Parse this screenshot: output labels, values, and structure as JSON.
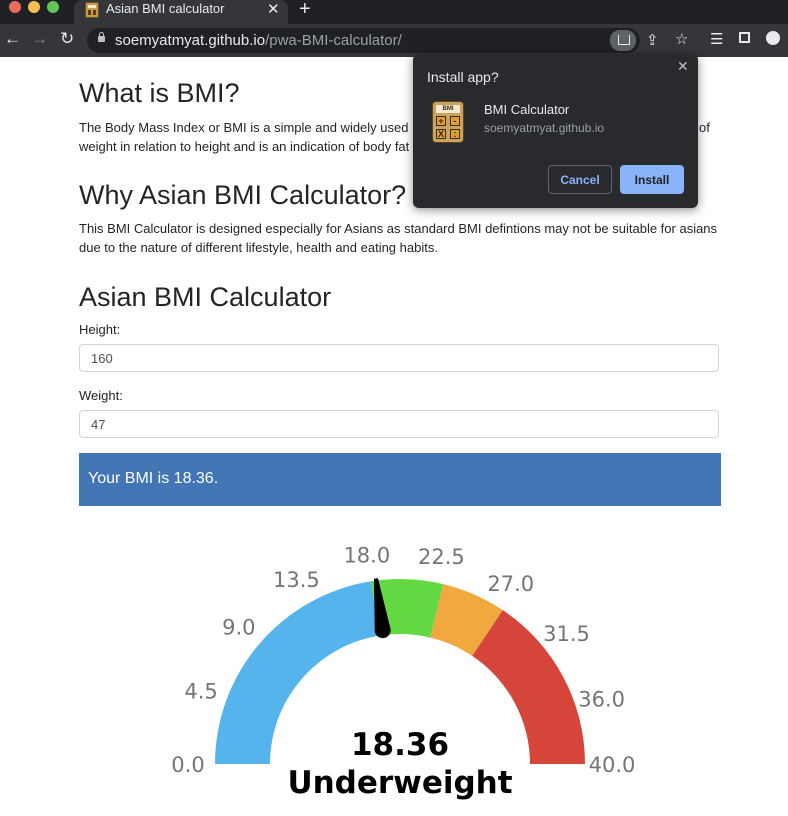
{
  "browser": {
    "tab_title": "Asian BMI calculator",
    "tab_close": "✕",
    "new_tab": "+",
    "url_host": "soemyatmyat.github.io",
    "url_path": "/pwa-BMI-calculator/",
    "traffic_colors": [
      "#ed6a5e",
      "#f5bf4f",
      "#61c554"
    ]
  },
  "install_popup": {
    "title": "Install app?",
    "close": "✕",
    "app_name": "BMI Calculator",
    "app_origin": "soemyatmyat.github.io",
    "icon_display": "BMI",
    "icon_keys": [
      "+",
      "-",
      "X",
      ":"
    ],
    "cancel_label": "Cancel",
    "install_label": "Install"
  },
  "sections": {
    "what_heading": "What is BMI?",
    "what_text": "The Body Mass Index or BMI is a simple and widely used measure of the amount of weight in relation to height and is an indication of body fat but not a direct measure of weight in relation to height and is an indication of body fat bu",
    "what_line1": "The Body Mass Index or BMI is a simple and widely used me",
    "what_line1_tail": "of",
    "what_line2": "weight in relation to height and is an indication of body fat bu",
    "why_heading": "Why Asian BMI Calculator?",
    "why_text": "This BMI Calculator is designed especially for Asians as standard BMI defintions may not be suitable for asians due to the nature of different lifestyle, health and eating habits.",
    "calc_heading": "Asian BMI Calculator"
  },
  "form": {
    "height_label": "Height:",
    "height_value": "160",
    "weight_label": "Weight:",
    "weight_value": "47",
    "result_text": "Your BMI is 18.36."
  },
  "chart_data": {
    "type": "gauge",
    "min": 0,
    "max": 40,
    "value": 18.36,
    "value_label": "18.36",
    "category_label": "Underweight",
    "tick_labels": [
      "0.0",
      "4.5",
      "9.0",
      "13.5",
      "18.0",
      "22.5",
      "27.0",
      "31.5",
      "36.0",
      "40.0"
    ],
    "tick_values": [
      0,
      4.5,
      9,
      13.5,
      18,
      22.5,
      27,
      31.5,
      36,
      40
    ],
    "bands": [
      {
        "from": 0,
        "to": 18,
        "color": "#56b4ed"
      },
      {
        "from": 18,
        "to": 23,
        "color": "#62d943"
      },
      {
        "from": 23,
        "to": 27.5,
        "color": "#f0a83f"
      },
      {
        "from": 27.5,
        "to": 40,
        "color": "#d6453a"
      }
    ],
    "needle_color": "#000000",
    "label_color": "#757575"
  }
}
